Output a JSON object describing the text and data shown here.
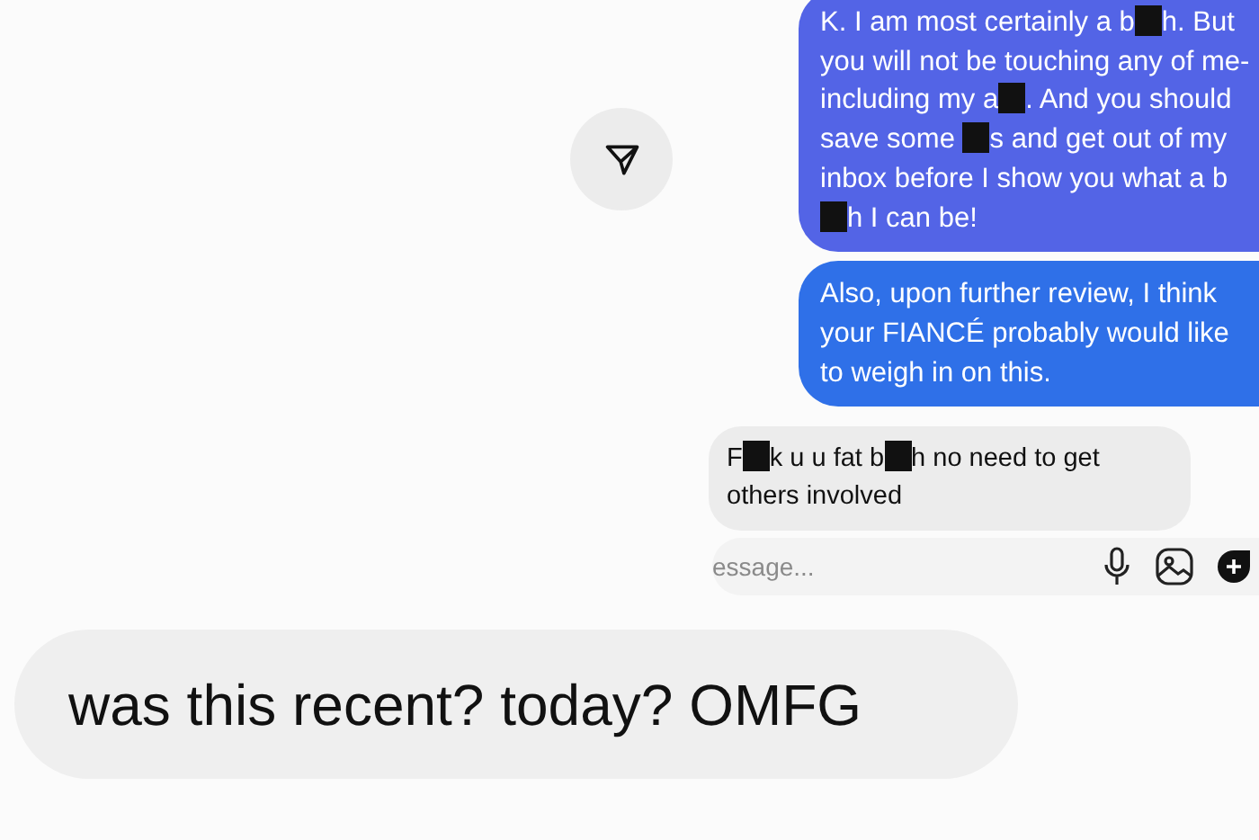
{
  "messages": [
    {
      "kind": "sent",
      "parts": [
        {
          "kind": "text",
          "text": "K. I am most certainly a b"
        },
        {
          "kind": "redacted"
        },
        {
          "kind": "text",
          "text": "h. But you will not be touching any of me- including my a"
        },
        {
          "kind": "redacted"
        },
        {
          "kind": "text",
          "text": ". And you should save some "
        },
        {
          "kind": "redacted"
        },
        {
          "kind": "text",
          "text": "s and get out of my inbox before I show you what a b"
        },
        {
          "kind": "redacted"
        },
        {
          "kind": "text",
          "text": "h I can be!"
        }
      ]
    },
    {
      "kind": "sent",
      "parts": [
        {
          "kind": "text",
          "text": "Also, upon further review, I think your FIANCÉ probably would like to weigh in on this."
        }
      ]
    },
    {
      "kind": "received",
      "parts": [
        {
          "kind": "text",
          "text": "F"
        },
        {
          "kind": "redacted"
        },
        {
          "kind": "text",
          "text": "k u u fat b"
        },
        {
          "kind": "redacted"
        },
        {
          "kind": "text",
          "text": "h no need to get others involved"
        }
      ]
    }
  ],
  "composer": {
    "placeholder": "essage..."
  },
  "comment": {
    "text": "was this recent? today? OMFG"
  }
}
